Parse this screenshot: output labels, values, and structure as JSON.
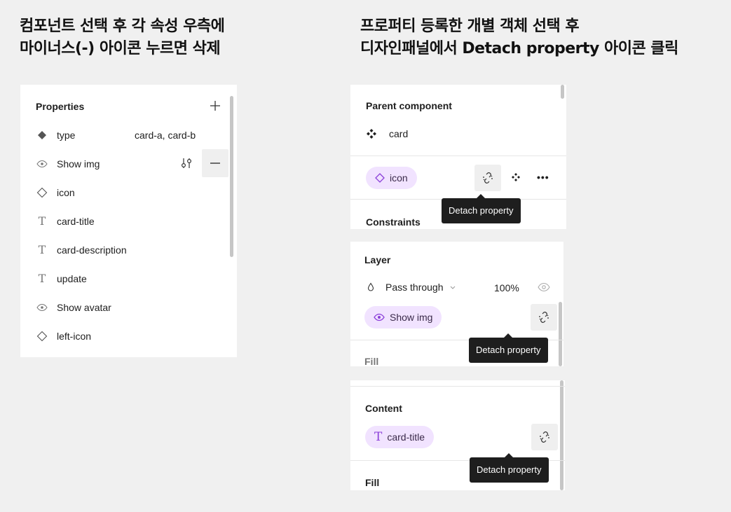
{
  "headings": {
    "left": [
      "컴포넌트 선택 후 각 속성 우측에",
      "마이너스(-) 아이콘 누르면 삭제"
    ],
    "right": [
      "프로퍼티 등록한 개별 객체 선택 후",
      "디자인패널에서 Detach property 아이콘 클릭"
    ]
  },
  "properties_panel": {
    "title": "Properties",
    "add_symbol": "+",
    "remove_symbol": "—",
    "items": [
      {
        "icon": "variant-diamond-filled-icon",
        "name": "type",
        "value": "card-a, card-b"
      },
      {
        "icon": "eye-icon",
        "name": "Show img",
        "value": ""
      },
      {
        "icon": "instance-diamond-outline-icon",
        "name": "icon",
        "value": ""
      },
      {
        "icon": "text-icon",
        "name": "card-title",
        "value": ""
      },
      {
        "icon": "text-icon",
        "name": "card-description",
        "value": ""
      },
      {
        "icon": "text-icon",
        "name": "update",
        "value": ""
      },
      {
        "icon": "eye-icon",
        "name": "Show avatar",
        "value": ""
      },
      {
        "icon": "instance-diamond-outline-icon",
        "name": "left-icon",
        "value": ""
      }
    ]
  },
  "panel_parent": {
    "section_title": "Parent component",
    "component_name": "card",
    "chip_label": "icon",
    "more_label": "•••",
    "tooltip": "Detach property",
    "next_section": "Constraints"
  },
  "panel_layer": {
    "section_title": "Layer",
    "blend_mode": "Pass through",
    "opacity": "100%",
    "chip_label": "Show img",
    "tooltip": "Detach property",
    "next_section": "Fill"
  },
  "panel_content": {
    "section_title": "Content",
    "chip_label": "card-title",
    "tooltip": "Detach property",
    "next_section": "Fill"
  },
  "colors": {
    "chip_bg": "#f1e3ff",
    "chip_icon": "#8b3fd9",
    "tooltip_bg": "#1e1e1e",
    "page_bg": "#f0f0f0"
  }
}
